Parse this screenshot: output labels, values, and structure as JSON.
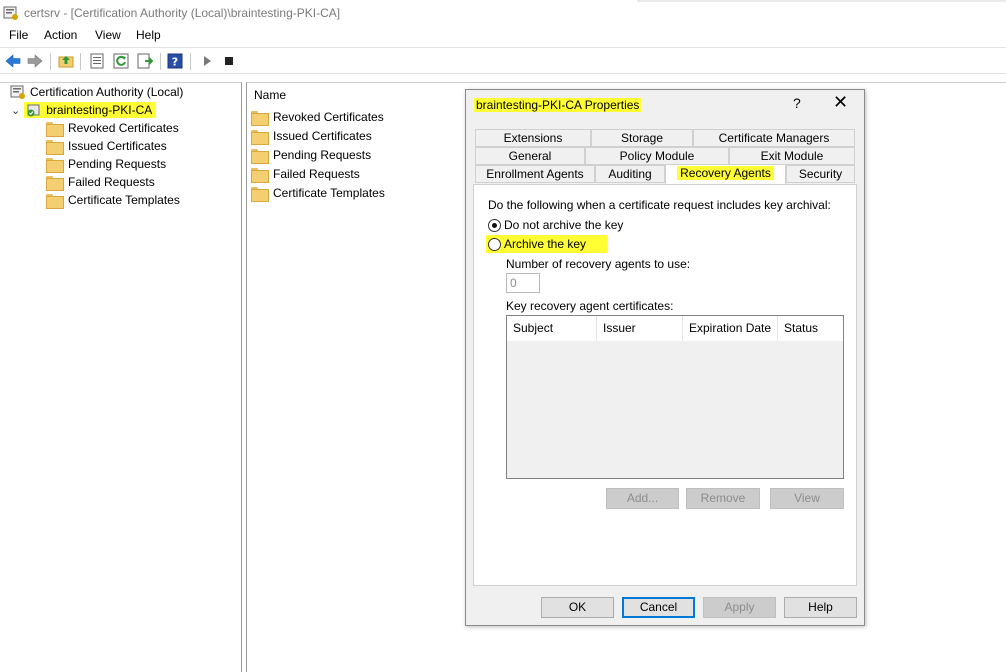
{
  "window": {
    "title": "certsrv - [Certification Authority (Local)\\braintesting-PKI-CA]"
  },
  "menu": [
    "File",
    "Action",
    "View",
    "Help"
  ],
  "tree": {
    "root": "Certification Authority (Local)",
    "ca": "braintesting-PKI-CA",
    "children": [
      "Revoked Certificates",
      "Issued Certificates",
      "Pending Requests",
      "Failed Requests",
      "Certificate Templates"
    ]
  },
  "list": {
    "header": "Name",
    "items": [
      "Revoked Certificates",
      "Issued Certificates",
      "Pending Requests",
      "Failed Requests",
      "Certificate Templates"
    ]
  },
  "dialog": {
    "title": "braintesting-PKI-CA Properties",
    "help": "?",
    "close": "✕",
    "tabs_row1": [
      "Extensions",
      "Storage",
      "Certificate Managers"
    ],
    "tabs_row2": [
      "General",
      "Policy Module",
      "Exit Module"
    ],
    "tabs_row3": [
      "Enrollment Agents",
      "Auditing",
      "Recovery Agents",
      "Security"
    ],
    "active_tab": "Recovery Agents",
    "instruction": "Do the following when a certificate request includes key archival:",
    "option_no_archive": "Do not archive the key",
    "option_archive": "Archive the key",
    "num_agents_label": "Number of recovery agents to use:",
    "num_agents_value": "0",
    "kra_label": "Key recovery agent certificates:",
    "columns": [
      "Subject",
      "Issuer",
      "Expiration Date",
      "Status"
    ],
    "add": "Add...",
    "remove": "Remove",
    "view": "View",
    "ok": "OK",
    "cancel": "Cancel",
    "apply": "Apply",
    "help_btn": "Help"
  },
  "colors": {
    "highlight": "#ffff33",
    "accent": "#0078d7"
  }
}
